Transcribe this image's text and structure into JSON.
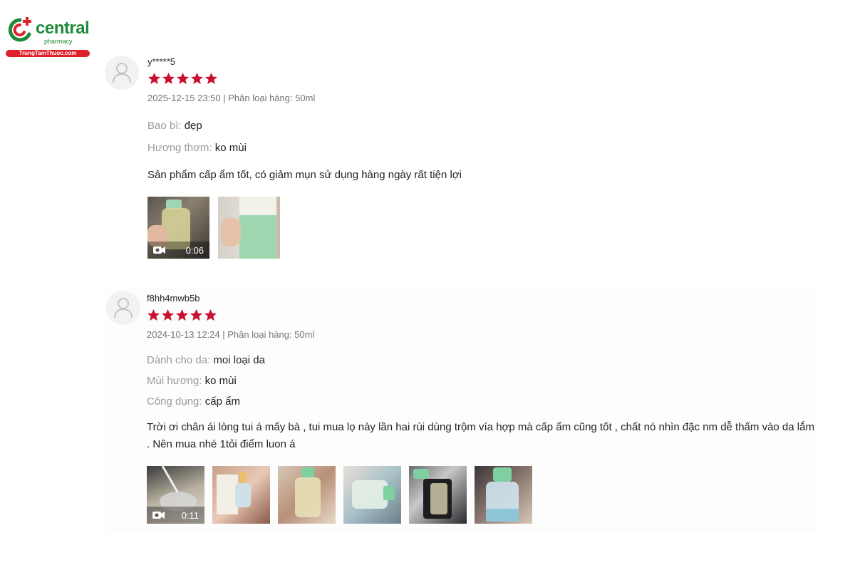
{
  "brand": {
    "name": "central",
    "sub": "pharmacy",
    "url": "TrungTamThuoc.com",
    "green": "#1f8a3b",
    "red": "#e0202a"
  },
  "star_color": "#c8102e",
  "reviews": [
    {
      "username": "y*****5",
      "rating": 5,
      "meta": "2025-12-15 23:50 | Phân loại hàng: 50ml",
      "attributes": [
        {
          "key": "Bao bì:",
          "value": "đẹp"
        },
        {
          "key": "Hương thơm:",
          "value": "ko mùi"
        }
      ],
      "text": "Sản phẩm cấp ẩm tốt, có giảm mụn sử dụng hàng ngày rất tiện lợi",
      "video_duration": "0:06",
      "media_count": 2
    },
    {
      "username": "f8hh4mwb5b",
      "rating": 5,
      "meta": "2024-10-13 12:24 | Phân loại hàng: 50ml",
      "attributes": [
        {
          "key": "Dành cho da:",
          "value": "moi loại da"
        },
        {
          "key": "Mùi hương:",
          "value": "ko mùi"
        },
        {
          "key": "Công dụng:",
          "value": "cấp ẩm"
        }
      ],
      "text": "Trời ơi chân ái lòng tui á mấy bà , tui mua lọ này lần hai rùi dùng trộm vía hợp mà cấp ẩm cũng tốt , chất nó nhìn đặc nm dễ thấm vào da lắm . Nên mua nhé 1tỏi điểm luon á",
      "video_duration": "0:11",
      "media_count": 6
    }
  ]
}
